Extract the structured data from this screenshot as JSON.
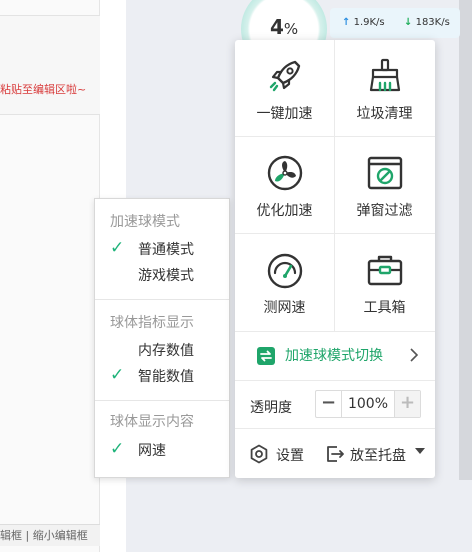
{
  "editor": {
    "paste_hint": "粘贴至编辑区啦~",
    "status_bar": "辑框 | 缩小编辑框"
  },
  "speed_ball": {
    "value": "4",
    "unit": "%",
    "upload": "1.9K/s",
    "download": "183K/s"
  },
  "mode_menu": {
    "sections": [
      {
        "title": "加速球模式",
        "items": [
          {
            "label": "普通模式",
            "checked": true
          },
          {
            "label": "游戏模式",
            "checked": false
          }
        ]
      },
      {
        "title": "球体指标显示",
        "items": [
          {
            "label": "内存数值",
            "checked": false
          },
          {
            "label": "智能数值",
            "checked": true
          }
        ]
      },
      {
        "title": "球体显示内容",
        "items": [
          {
            "label": "网速",
            "checked": true
          }
        ]
      }
    ],
    "check_glyph": "✓"
  },
  "panel": {
    "tiles": [
      {
        "label": "一键加速",
        "icon": "rocket-icon"
      },
      {
        "label": "垃圾清理",
        "icon": "broom-icon"
      },
      {
        "label": "优化加速",
        "icon": "fan-icon"
      },
      {
        "label": "弹窗过滤",
        "icon": "popup-block-icon"
      },
      {
        "label": "测网速",
        "icon": "gauge-icon"
      },
      {
        "label": "工具箱",
        "icon": "toolbox-icon"
      }
    ],
    "switch_label": "加速球模式切换",
    "opacity_label": "透明度",
    "opacity_value": "100%",
    "minus_glyph": "−",
    "plus_glyph": "+",
    "settings_label": "设置",
    "tray_label": "放至托盘",
    "accent_color": "#1fa56a"
  }
}
